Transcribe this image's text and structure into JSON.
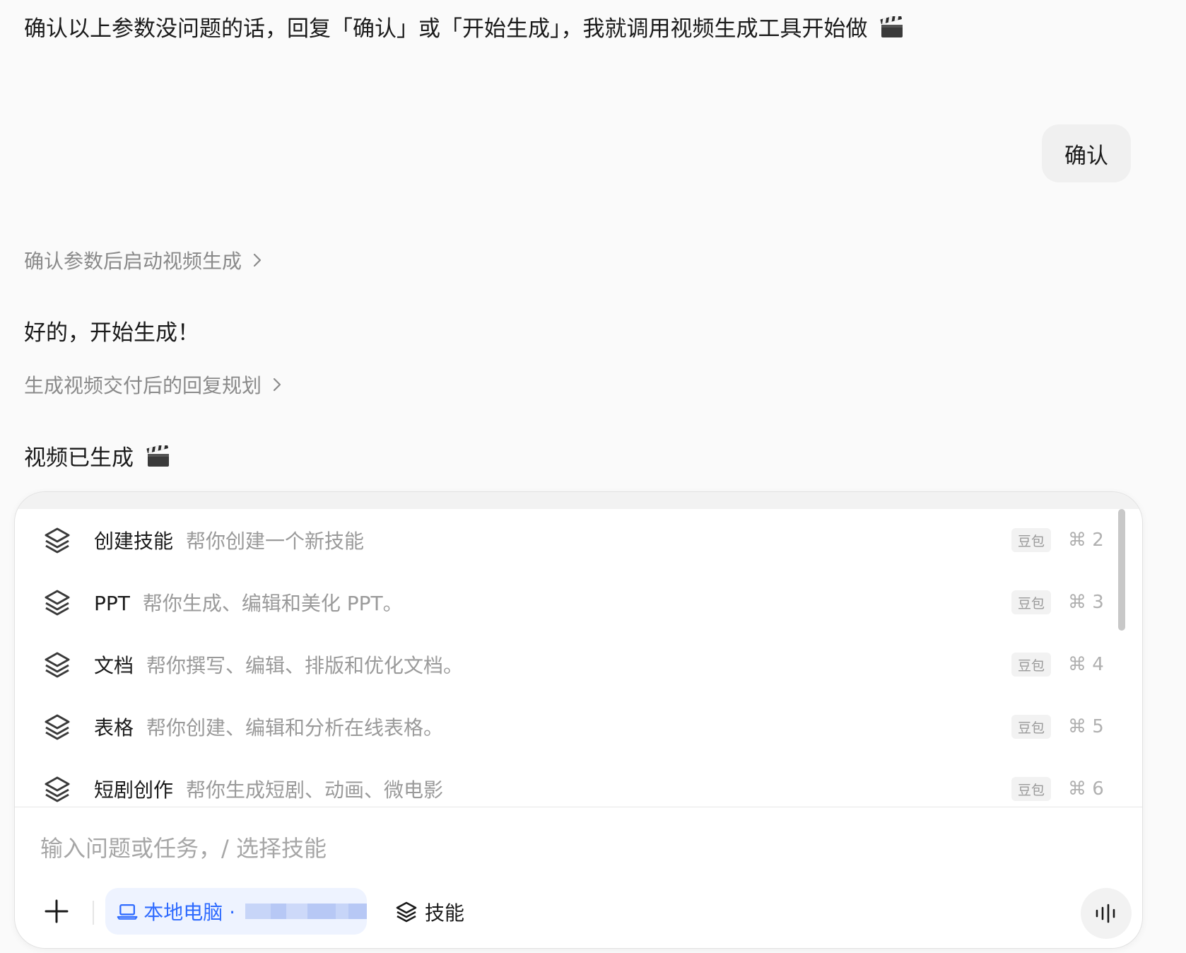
{
  "conversation": {
    "assistant_prompt": "确认以上参数没问题的话，回复「确认」或「开始生成」，我就调用视频生成工具开始做",
    "user_reply": "确认",
    "thought_1": "确认参数后启动视频生成",
    "assistant_reply_1": "好的，开始生成！",
    "thought_2": "生成视频交付后的回复规划",
    "assistant_reply_2": "视频已生成"
  },
  "skills_menu": {
    "items": [
      {
        "name": "创建技能",
        "description": "帮你创建一个新技能",
        "badge": "豆包",
        "shortcut": "⌘ 2"
      },
      {
        "name": "PPT",
        "description": "帮你生成、编辑和美化 PPT。",
        "badge": "豆包",
        "shortcut": "⌘ 3"
      },
      {
        "name": "文档",
        "description": "帮你撰写、编辑、排版和优化文档。",
        "badge": "豆包",
        "shortcut": "⌘ 4"
      },
      {
        "name": "表格",
        "description": "帮你创建、编辑和分析在线表格。",
        "badge": "豆包",
        "shortcut": "⌘ 5"
      },
      {
        "name": "短剧创作",
        "description": "帮你生成短剧、动画、微电影",
        "badge": "豆包",
        "shortcut": "⌘ 6"
      }
    ]
  },
  "composer": {
    "placeholder": "输入问题或任务，/ 选择技能",
    "env_label": "本地电脑 ·",
    "skills_label": "技能"
  },
  "colors": {
    "accent": "#2f6bff",
    "background": "#fafafa"
  }
}
